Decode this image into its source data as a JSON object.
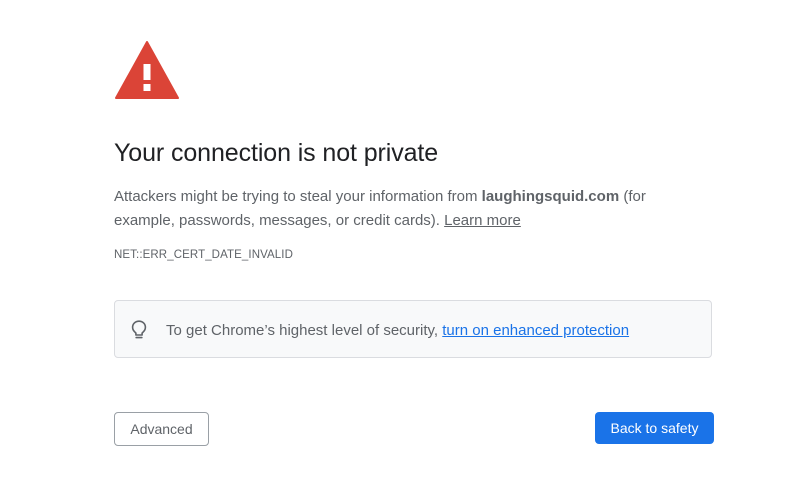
{
  "warning": {
    "icon": "warning-triangle-icon",
    "color": "#db4437"
  },
  "title": "Your connection is not private",
  "message": {
    "before": "Attackers might be trying to steal your information from ",
    "domain": "laughingsquid.com",
    "after": " (for example, passwords, messages, or credit cards). ",
    "learn_more": "Learn more"
  },
  "error_code": "NET::ERR_CERT_DATE_INVALID",
  "security_box": {
    "icon": "lightbulb-icon",
    "text": "To get Chrome’s highest level of security, ",
    "link": "turn on enhanced protection"
  },
  "buttons": {
    "advanced": "Advanced",
    "back_to_safety": "Back to safety"
  },
  "colors": {
    "accent": "#1a73e8",
    "text_secondary": "#5f6368",
    "warning": "#db4437"
  }
}
